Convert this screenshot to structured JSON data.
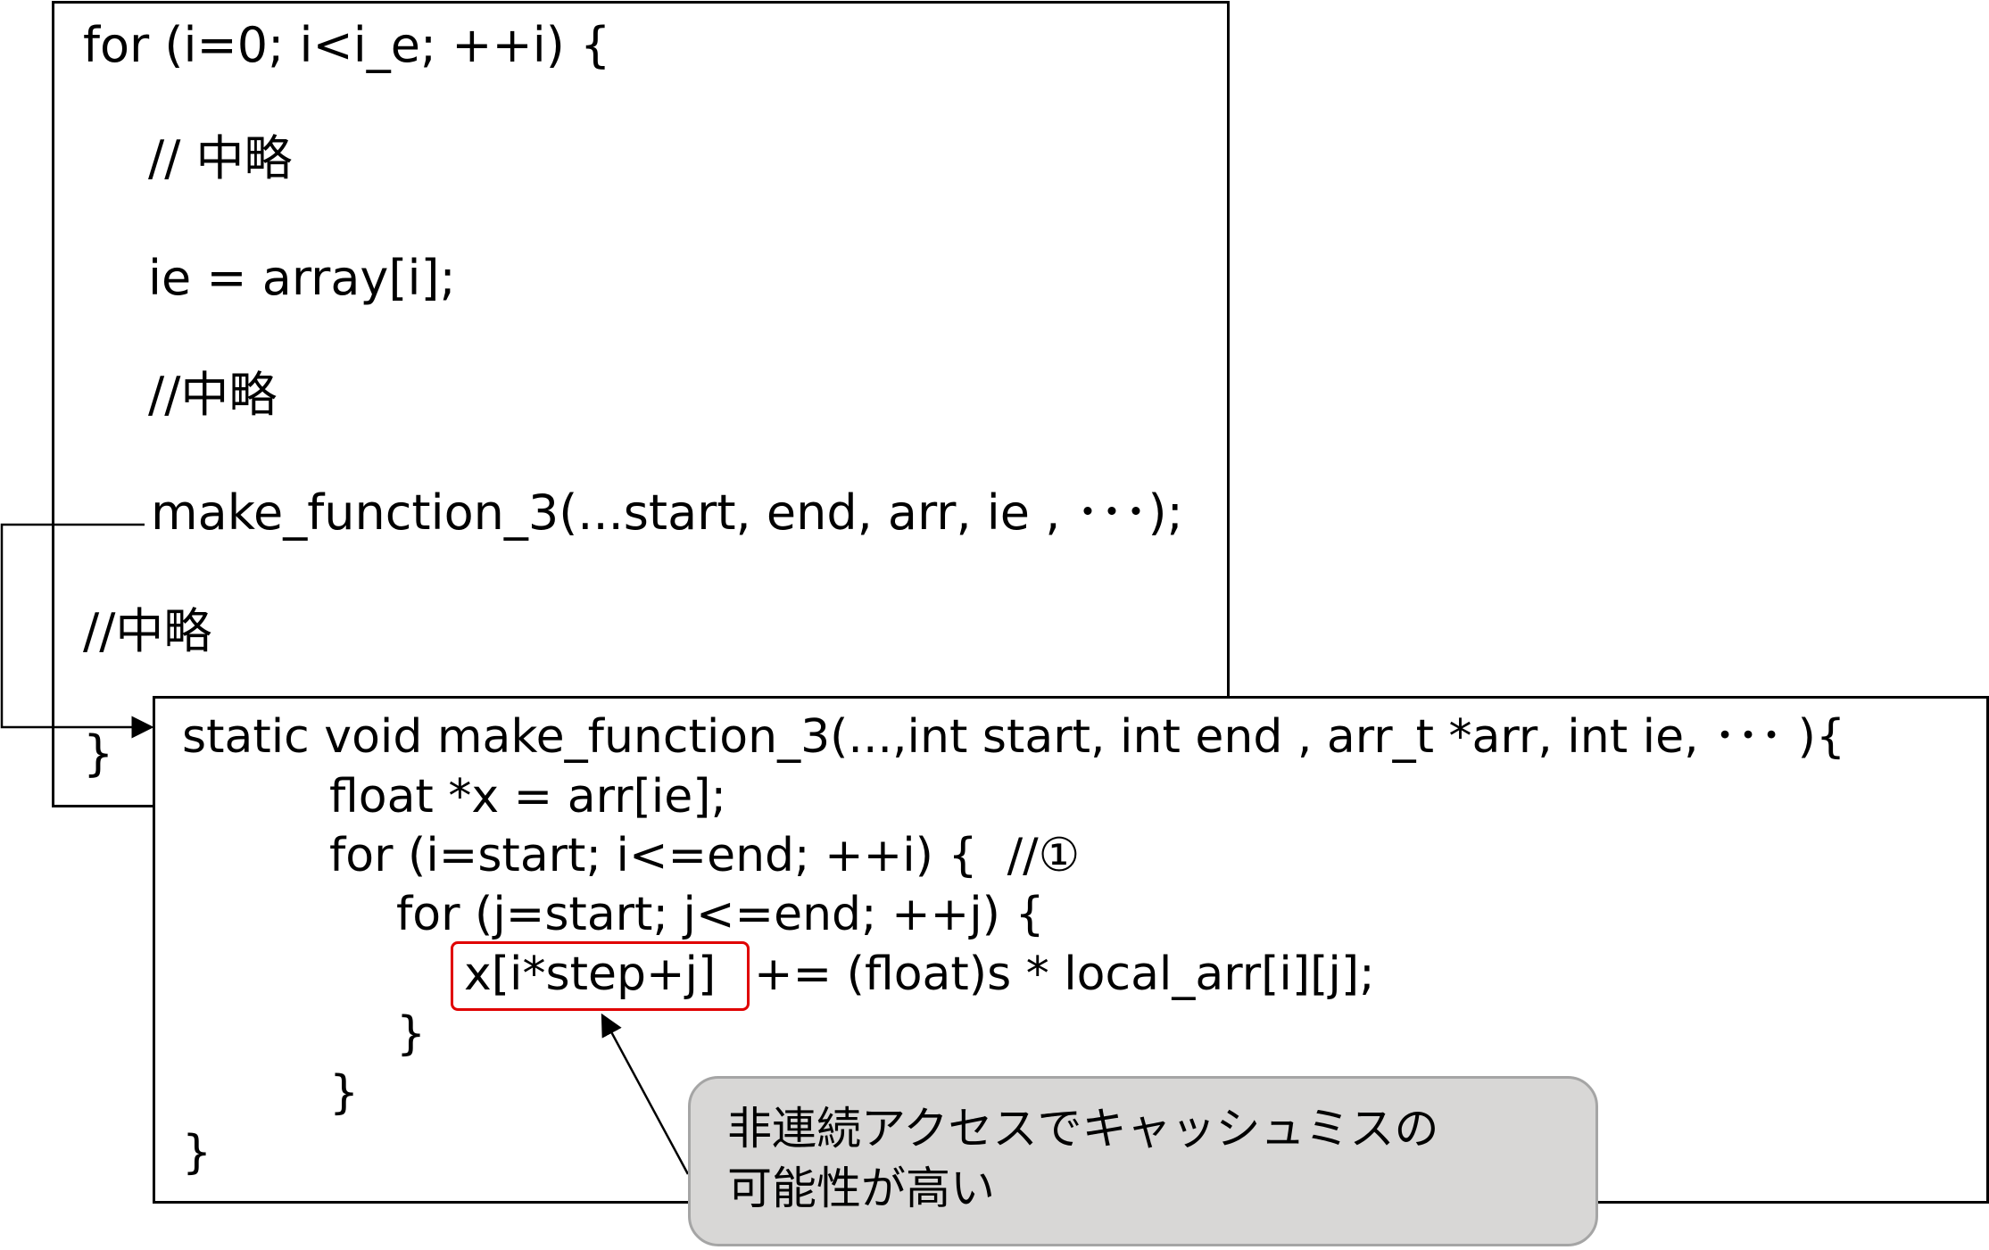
{
  "outer_code": {
    "line1": "for (i=0; i<i_e; ++i) {",
    "line2": "// 中略",
    "line3": "ie = array[i];",
    "line4": "//中略",
    "line5": "make_function_3(...start, end, arr, ie , ･･･);",
    "line6": "//中略",
    "line7": "}"
  },
  "inner_code": {
    "line1": "static void make_function_3(...,int start, int end , arr_t *arr, int ie, ･･･ ){",
    "line2": "float *x = arr[ie];",
    "line3": "for (i=start; i<=end; ++i) {  //①",
    "line4": "for (j=start; j<=end; ++j) {",
    "line5a": "x[i*step+j]",
    "line5b": "+= (float)s * local_arr[i][j];",
    "line6": "}",
    "line7": "}",
    "line8": "}"
  },
  "callout": {
    "line1": "非連続アクセスでキャッシュミスの",
    "line2": "可能性が高い"
  },
  "colors": {
    "highlight": "#e00000",
    "callout_fill": "#d8d7d6",
    "callout_border": "#a5a5a5"
  }
}
